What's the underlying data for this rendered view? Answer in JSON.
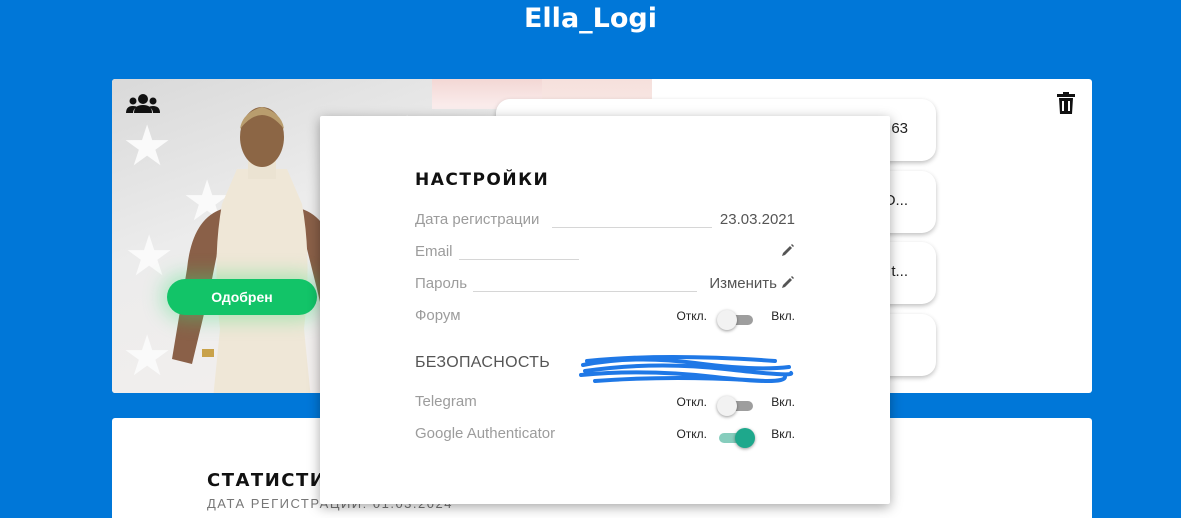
{
  "header": {
    "title": "Ella_Logi"
  },
  "profile": {
    "status_button": "Одобрен",
    "tiles": [
      "63",
      "О...",
      "t...",
      ""
    ]
  },
  "stats": {
    "title": "СТАТИСТИК",
    "subtitle": "ДАТА РЕГИСТРАЦИИ: 01.03.2024"
  },
  "settings": {
    "title": "НАСТРОЙКИ",
    "rows": {
      "registration": {
        "label": "Дата регистрации",
        "value": "23.03.2021"
      },
      "email": {
        "label": "Email",
        "value": ""
      },
      "password": {
        "label": "Пароль",
        "action": "Изменить"
      },
      "forum": {
        "label": "Форум",
        "off": "Откл.",
        "on": "Вкл.",
        "enabled": false
      }
    },
    "security": {
      "title": "БЕЗОПАСНОСТЬ",
      "telegram": {
        "label": "Telegram",
        "off": "Откл.",
        "on": "Вкл.",
        "enabled": false
      },
      "google_auth": {
        "label": "Google Authenticator",
        "off": "Откл.",
        "on": "Вкл.",
        "enabled": true
      }
    }
  },
  "colors": {
    "page_bg": "#0077d8",
    "approved": "#12c468",
    "toggle_on": "#1ea88c"
  },
  "icons": {
    "members": "users-icon",
    "delete": "trash-icon",
    "edit": "pencil-icon"
  }
}
